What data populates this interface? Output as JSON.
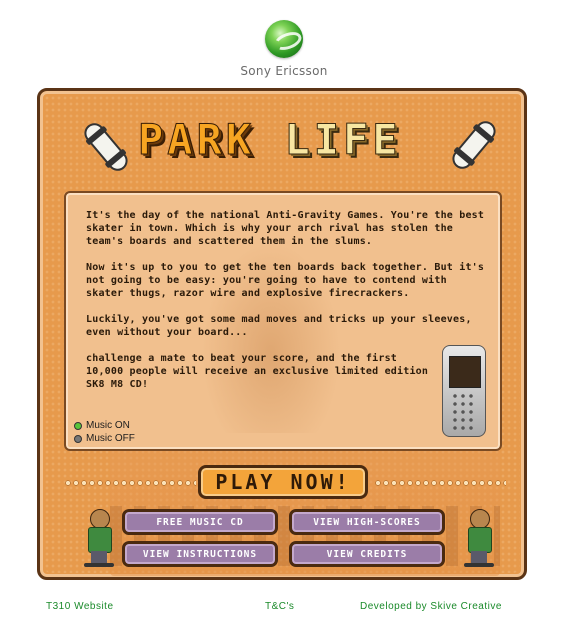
{
  "brand": {
    "name": "Sony Ericsson"
  },
  "game": {
    "title_part1": "PARK",
    "title_part2": "LIFE",
    "story": [
      "It's the day of the national Anti-Gravity Games. You're the best skater in town. Which is why your arch rival has stolen the team's boards and scattered them in the slums.",
      "Now it's up to you to get the ten boards back together. But it's not going to be easy: you're going to have to contend with skater thugs, razor wire and explosive firecrackers.",
      "Luckily, you've got some mad moves and tricks up your sleeves, even without your board...",
      "challenge a mate to beat your score, and the first 10,000 people will receive an exclusive limited edition SK8 M8 CD!"
    ],
    "music": {
      "on_label": "Music ON",
      "off_label": "Music OFF",
      "selected": "on"
    },
    "play_label": "PLAY NOW!",
    "buttons": {
      "free_music": "FREE MUSIC CD",
      "high_scores": "VIEW HIGH-SCORES",
      "instructions": "VIEW INSTRUCTIONS",
      "credits": "VIEW CREDITS"
    }
  },
  "footer": {
    "website": "T310 Website",
    "tc": "T&C's",
    "developer": "Developed by Skive Creative"
  },
  "colors": {
    "frame": "#e79a4c",
    "panel": "#f1c08e",
    "button": "#9b7da8",
    "play": "#f3a43a",
    "footer_link": "#1a8a2a"
  }
}
